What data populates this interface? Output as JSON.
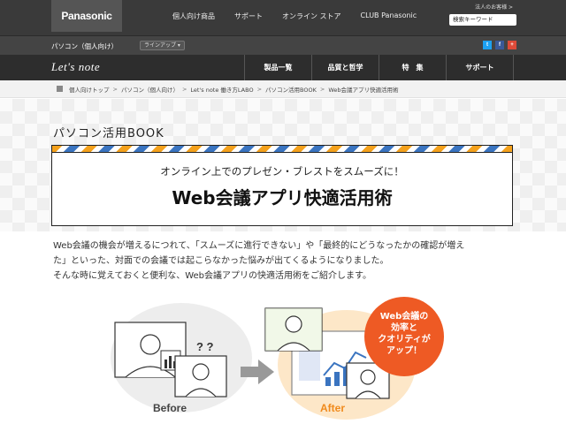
{
  "header": {
    "brand": "Panasonic",
    "nav": [
      "個人向け商品",
      "サポート",
      "オンライン ストア",
      "CLUB Panasonic"
    ],
    "corp_link": "法人のお客様 >",
    "search_placeholder": "検索キーワード"
  },
  "subheader": {
    "title": "パソコン（個人向け）",
    "lineup": "ラインアップ ▾",
    "social": [
      "t",
      "f",
      "+"
    ]
  },
  "product_bar": {
    "logo": "Let's note",
    "nav": [
      "製品一覧",
      "品質と哲学",
      "特　集",
      "サポート"
    ]
  },
  "breadcrumb": [
    "個人向けトップ",
    "パソコン（個人向け）",
    "Let's note 働き方LABO",
    "パソコン活用BOOK",
    "Web会議アプリ快適活用術"
  ],
  "hero": {
    "book_label": "パソコン活用BOOK",
    "subtitle": "オンライン上でのプレゼン・ブレストをスムーズに！",
    "title": "Web会議アプリ快適活用術"
  },
  "intro": {
    "line1": "Web会議の機会が増えるにつれて、「スムーズに進行できない」や「最終的にどうなったかの確認が増え",
    "line2": "た」といった、対面での会議では起こらなかった悩みが出てくるようになりました。",
    "line3": "そんな時に覚えておくと便利な、Web会議アプリの快適活用術をご紹介します。"
  },
  "illustration": {
    "before_label": "Before",
    "after_label": "After",
    "question_marks": "? ?",
    "badge_lines": [
      "Web会議の",
      "効率と",
      "クオリティが",
      "アップ！"
    ]
  },
  "colors": {
    "accent_orange": "#f08a1c",
    "badge_red": "#ee5a24",
    "stripe_blue": "#3a74c0",
    "topbar": "#3a3a3a"
  }
}
